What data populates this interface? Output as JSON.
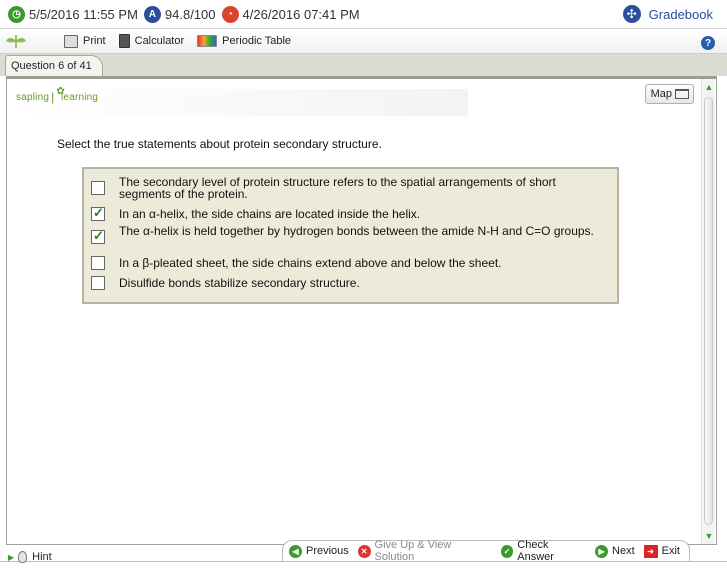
{
  "topbar": {
    "time_text": "5/5/2016 11:55 PM",
    "score_text": "94.8/100",
    "due_text": "4/26/2016 07:41 PM",
    "gradebook_label": "Gradebook"
  },
  "toolbar": {
    "print_label": "Print",
    "calculator_label": "Calculator",
    "periodic_label": "Periodic Table"
  },
  "tab": {
    "label": "Question 6 of 41"
  },
  "logo": {
    "left": "sapling",
    "right": "learning"
  },
  "map_label": "Map",
  "question": {
    "prompt": "Select the true statements about protein secondary structure.",
    "options": [
      {
        "text": "The secondary level of protein structure refers to the spatial arrangements of short segments of the protein.",
        "checked": false
      },
      {
        "text": "In an α-helix, the side chains are located inside the helix.",
        "checked": true
      },
      {
        "text": "The α-helix is held together by hydrogen bonds between the amide N-H and C=O groups.",
        "checked": true
      },
      {
        "text": "In a β-pleated sheet, the side chains extend above and below the sheet.",
        "checked": false
      },
      {
        "text": "Disulfide bonds stabilize secondary structure.",
        "checked": false
      }
    ]
  },
  "bottom": {
    "hint_label": "Hint",
    "previous_label": "Previous",
    "giveup_label": "Give Up & View Solution",
    "check_label": "Check Answer",
    "next_label": "Next",
    "exit_label": "Exit"
  },
  "colors": {
    "accent_green": "#3a9a2a",
    "brand_blue": "#2a4f9c",
    "options_bg": "#ecebda"
  }
}
